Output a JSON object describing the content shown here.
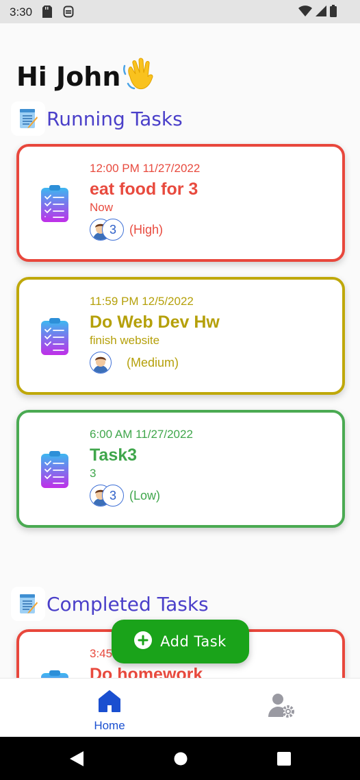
{
  "status_bar": {
    "time": "3:30",
    "left_icons": [
      "sd-card-icon",
      "sync-icon"
    ],
    "right_icons": [
      "wifi-icon",
      "signal-icon",
      "battery-icon"
    ]
  },
  "greeting": {
    "text": "Hi John",
    "emoji": "👋"
  },
  "sections": {
    "running": {
      "title": "Running Tasks",
      "icon": "notepad-icon"
    },
    "completed": {
      "title": "Completed Tasks",
      "icon": "notepad-icon"
    }
  },
  "running_tasks": [
    {
      "date": "12:00 PM 11/27/2022",
      "title": "eat food for 3",
      "desc": "Now",
      "count": "3",
      "priority": "(High)",
      "color": "#e84a3e",
      "border": "#e8473c"
    },
    {
      "date": "11:59 PM 12/5/2022",
      "title": "Do Web Dev Hw",
      "desc": "finish website",
      "count": "",
      "priority": "(Medium)",
      "color": "#b5a00a",
      "border": "#bfa80a"
    },
    {
      "date": "6:00 AM 11/27/2022",
      "title": "Task3",
      "desc": "3",
      "count": "3",
      "priority": "(Low)",
      "color": "#3fa64b",
      "border": "#4aaa52"
    }
  ],
  "completed_tasks": [
    {
      "date": "3:45",
      "title": "Do homework",
      "color": "#e84a3e",
      "border": "#e8473c"
    }
  ],
  "fab": {
    "label": "Add Task",
    "icon": "plus-circle-icon",
    "color": "#1aa31a"
  },
  "bottom_nav": {
    "home_label": "Home",
    "home_icon": "home-icon",
    "settings_icon": "user-settings-icon",
    "active_color": "#1a4fd0"
  },
  "system_nav": [
    "back-icon",
    "home-circle-icon",
    "recents-icon"
  ]
}
